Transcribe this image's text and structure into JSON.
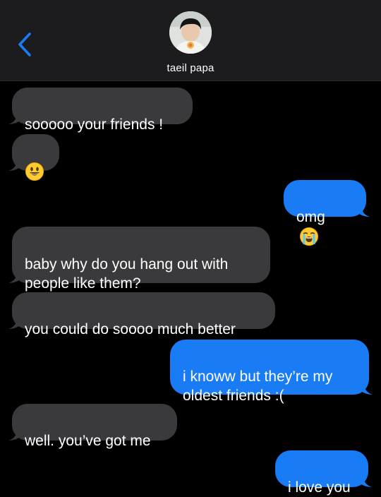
{
  "header": {
    "contact_name": "taeil papa",
    "back_icon": "chevron-left-icon",
    "accent_color": "#1a7cf5"
  },
  "messages": [
    {
      "direction": "in",
      "text": "sooooo your friends !"
    },
    {
      "direction": "in",
      "text": "",
      "emoji": "smiley-face"
    },
    {
      "direction": "out",
      "text": "omg",
      "emoji": "loudly-crying-face"
    },
    {
      "direction": "in",
      "text": "baby why do you hang out with\npeople like them?"
    },
    {
      "direction": "in",
      "text": "you could do soooo much better"
    },
    {
      "direction": "out",
      "text": "i knoww but they’re my\noldest friends :("
    },
    {
      "direction": "in",
      "text": "well. you’ve got me"
    },
    {
      "direction": "out",
      "text": "i love you"
    }
  ],
  "colors": {
    "incoming_bubble": "#3a3a3c",
    "outgoing_bubble": "#1a7cf5",
    "background": "#000000",
    "header_background": "#1c1c1e"
  }
}
